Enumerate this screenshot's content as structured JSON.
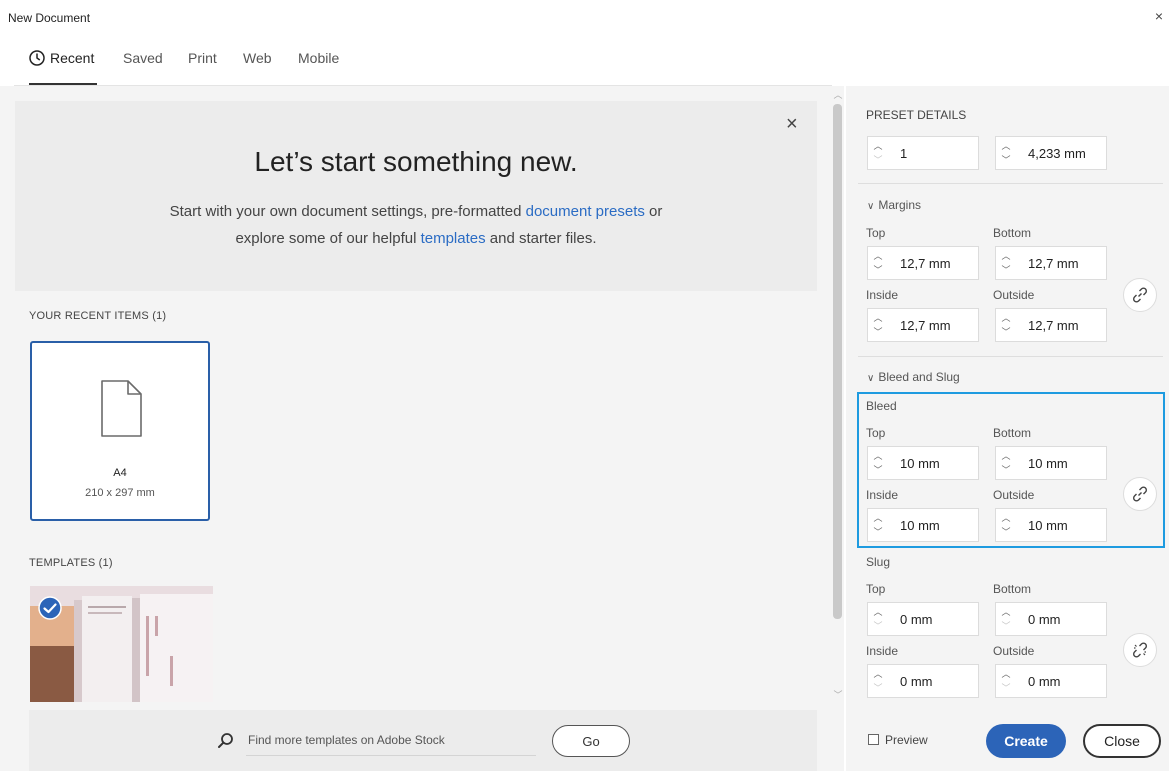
{
  "window": {
    "title": "New Document",
    "close_glyph": "×"
  },
  "tabs": [
    {
      "label": "Recent"
    },
    {
      "label": "Saved"
    },
    {
      "label": "Print"
    },
    {
      "label": "Web"
    },
    {
      "label": "Mobile"
    }
  ],
  "hero": {
    "title": "Let’s start something new.",
    "line1_pre": "Start with your own document settings, pre-formatted ",
    "line1_link": "document presets",
    "line1_post": " or",
    "line2_pre": "explore some of our helpful ",
    "line2_link": "templates",
    "line2_post": " and starter files.",
    "close_glyph": "×"
  },
  "recent": {
    "heading": "YOUR RECENT ITEMS",
    "count": "(1)",
    "item_name": "A4",
    "item_size": "210 x 297 mm"
  },
  "templates": {
    "heading": "TEMPLATES",
    "count": "(1)"
  },
  "search": {
    "placeholder": "Find more templates on Adobe Stock",
    "go_label": "Go"
  },
  "preset": {
    "heading": "PRESET DETAILS",
    "pages": "1",
    "gutter": "4,233 mm"
  },
  "margins": {
    "heading": "Margins",
    "top_label": "Top",
    "bottom_label": "Bottom",
    "inside_label": "Inside",
    "outside_label": "Outside",
    "top": "12,7 mm",
    "bottom": "12,7 mm",
    "inside": "12,7 mm",
    "outside": "12,7 mm"
  },
  "bleed_slug": {
    "heading": "Bleed and Slug",
    "bleed_label": "Bleed",
    "slug_label": "Slug",
    "top_label": "Top",
    "bottom_label": "Bottom",
    "inside_label": "Inside",
    "outside_label": "Outside",
    "bleed_top": "10 mm",
    "bleed_bottom": "10 mm",
    "bleed_inside": "10 mm",
    "bleed_outside": "10 mm",
    "slug_top": "0 mm",
    "slug_bottom": "0 mm",
    "slug_inside": "0 mm",
    "slug_outside": "0 mm"
  },
  "footer": {
    "preview_label": "Preview",
    "create_label": "Create",
    "close_label": "Close"
  },
  "colors": {
    "accent": "#2c64b8",
    "link": "#2b6cc4",
    "highlight": "#1e9be0"
  }
}
